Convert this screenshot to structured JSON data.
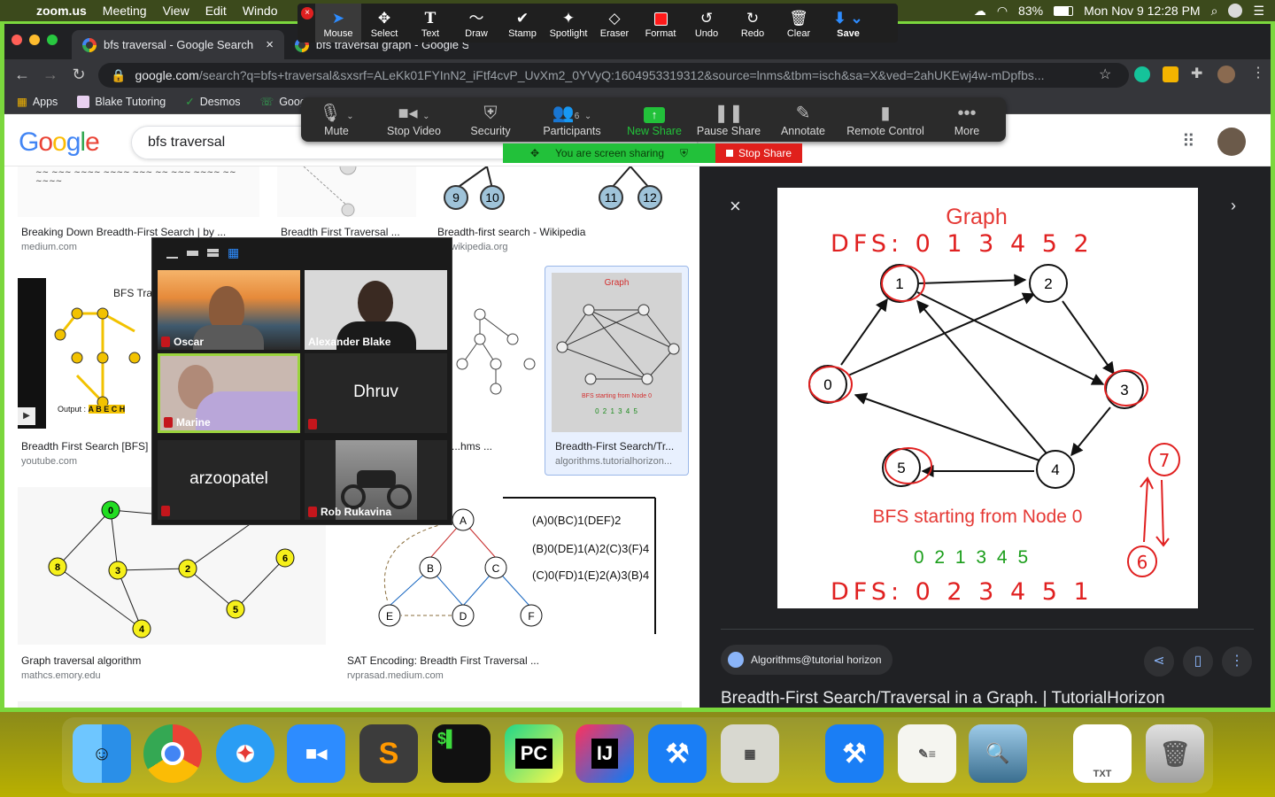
{
  "menubar": {
    "app": "zoom.us",
    "items": [
      "Meeting",
      "View",
      "Edit",
      "Windo"
    ],
    "battery": "83%",
    "datetime": "Mon Nov 9  12:28 PM"
  },
  "annotate_toolbar": {
    "tools": [
      {
        "label": "Mouse",
        "icon": "cursor-icon"
      },
      {
        "label": "Select",
        "icon": "move-icon"
      },
      {
        "label": "Text",
        "icon": "text-icon"
      },
      {
        "label": "Draw",
        "icon": "draw-icon"
      },
      {
        "label": "Stamp",
        "icon": "stamp-icon"
      },
      {
        "label": "Spotlight",
        "icon": "spotlight-icon"
      },
      {
        "label": "Eraser",
        "icon": "eraser-icon"
      },
      {
        "label": "Format",
        "icon": "format-icon"
      },
      {
        "label": "Undo",
        "icon": "undo-icon"
      },
      {
        "label": "Redo",
        "icon": "redo-icon"
      },
      {
        "label": "Clear",
        "icon": "trash-icon"
      },
      {
        "label": "Save",
        "icon": "save-icon"
      }
    ],
    "format_color": "#ff1a1a"
  },
  "browser": {
    "tabs": [
      {
        "title": "bfs traversal - Google Search",
        "active": true
      },
      {
        "title": "bfs traversal graph - Google S",
        "active": false
      }
    ],
    "url_host": "google.com",
    "url_rest": "/search?q=bfs+traversal&sxsrf=ALeKk01FYInN2_iFtf4cvP_UvXm2_0YVyQ:1604953319312&source=lnms&tbm=isch&sa=X&ved=2ahUKEwj4w-mDpfbs...",
    "bookmarks": [
      "Apps",
      "Blake Tutoring",
      "Desmos",
      "Goog"
    ]
  },
  "zoom_bar": {
    "buttons": [
      {
        "label": "Mute",
        "icon": "microphone-icon"
      },
      {
        "label": "Stop Video",
        "icon": "video-camera-icon"
      },
      {
        "label": "Security",
        "icon": "shield-icon"
      },
      {
        "label": "Participants",
        "icon": "participants-icon",
        "count": "6"
      },
      {
        "label": "New Share",
        "icon": "new-share-icon"
      },
      {
        "label": "Pause Share",
        "icon": "pause-icon"
      },
      {
        "label": "Annotate",
        "icon": "pencil-icon"
      },
      {
        "label": "Remote Control",
        "icon": "mouse-icon"
      },
      {
        "label": "More",
        "icon": "more-icon"
      }
    ],
    "sharing_text": "You are screen sharing",
    "stop_share": "Stop Share"
  },
  "google": {
    "query": "bfs traversal",
    "results": [
      {
        "title": "Breaking Down Breadth-First Search | by ...",
        "source": "medium.com"
      },
      {
        "title": "Breadth First Traversal ...",
        "source": ""
      },
      {
        "title": "Breadth-first search - Wikipedia",
        "source": "en.wikipedia.org"
      },
      {
        "title": "Breadth First Search [BFS] ...",
        "source": "youtube.com"
      },
      {
        "title": "...hms ...",
        "source": ""
      },
      {
        "title": "Breadth-First Search/Tr...",
        "source": "algorithms.tutorialhorizon..."
      },
      {
        "title": "Graph traversal algorithm",
        "source": "mathcs.emory.edu"
      },
      {
        "title": "SAT Encoding: Breadth First Traversal ...",
        "source": "rvprasad.medium.com"
      }
    ],
    "thumb_labels": {
      "bfs_title": "BFS Tra",
      "output": "Output :",
      "output_seq": "A B E C H",
      "small_graph": "Graph",
      "small_bfs": "BFS starting from Node 0",
      "small_seq": "0 2 1 3 4 5",
      "sat_lines": [
        "(A)0(BC)1(DEF)2",
        "(B)0(DE)1(A)2(C)3(F)4",
        "(C)0(FD)1(E)2(A)3(B)4"
      ]
    }
  },
  "gallery": {
    "participants": [
      {
        "name": "Oscar",
        "muted": true,
        "video": true
      },
      {
        "name": "Alexander Blake",
        "muted": false,
        "video": true
      },
      {
        "name": "Marine",
        "muted": true,
        "video": true,
        "active": true
      },
      {
        "name": "Dhruv",
        "muted": true,
        "video": false
      },
      {
        "name": "arzoopatel",
        "muted": true,
        "video": false
      },
      {
        "name": "Rob Rukavina",
        "muted": true,
        "video": true
      }
    ]
  },
  "preview": {
    "graph_title": "Graph",
    "bfs_caption": "BFS starting from Node 0",
    "sequence": "0 2 1 3 4 5",
    "handwritten_top": "DFS: 0 1 3 4 5 2",
    "handwritten_bottom": "DFS: 0 2 3 4 5 1",
    "handwritten_nodes": [
      "7",
      "6"
    ],
    "nodes": [
      "0",
      "1",
      "2",
      "3",
      "4",
      "5"
    ],
    "source_chip": "Algorithms@tutorial horizon",
    "caption": "Breadth-First Search/Traversal in a Graph. | TutorialHorizon"
  },
  "dock": {
    "apps": [
      "finder-icon",
      "chrome-icon",
      "safari-icon",
      "zoom-icon",
      "sublime-icon",
      "terminal-icon",
      "pycharm-icon",
      "intellij-icon",
      "xcode-icon",
      "calculator-icon",
      "xcode-icon",
      "textedit-icon",
      "preview-icon",
      "txt-file-icon",
      "trash-icon"
    ]
  }
}
